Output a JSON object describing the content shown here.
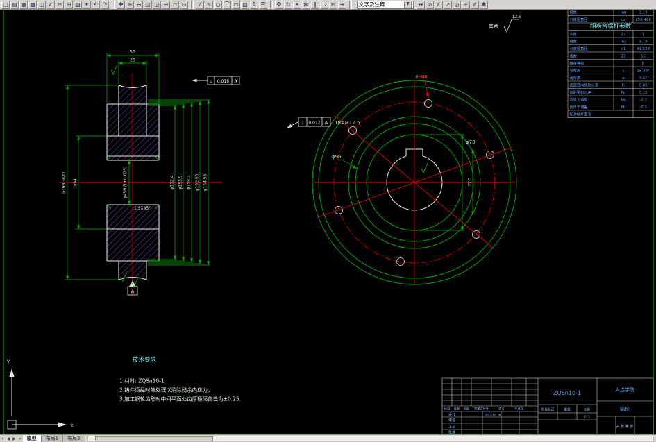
{
  "toolbar": {
    "style_combo": "文字及注释",
    "icons": [
      {
        "name": "new-icon",
        "glyph": "□"
      },
      {
        "name": "open-icon",
        "glyph": "▤"
      },
      {
        "name": "save-icon",
        "glyph": "▦"
      },
      {
        "name": "plot-icon",
        "glyph": "▩"
      },
      {
        "name": "plot-preview-icon",
        "glyph": "◫"
      },
      {
        "name": "spell-icon",
        "glyph": "✓"
      },
      {
        "name": "cut-icon",
        "glyph": "✂"
      },
      {
        "name": "copy-icon",
        "glyph": "⊞"
      },
      {
        "name": "paste-icon",
        "glyph": "▧"
      },
      {
        "name": "match-properties-icon",
        "glyph": "✦"
      },
      {
        "name": "undo-icon",
        "glyph": "↶"
      },
      {
        "name": "redo-icon",
        "glyph": "↷"
      },
      {
        "sep": true
      },
      {
        "name": "pan-icon",
        "glyph": "✚"
      },
      {
        "name": "zoom-realtime-icon",
        "glyph": "⊕"
      },
      {
        "name": "zoom-out-icon",
        "glyph": "⊖"
      },
      {
        "name": "zoom-window-icon",
        "glyph": "◱"
      },
      {
        "name": "zoom-previous-icon",
        "glyph": "◲"
      },
      {
        "name": "distance-icon",
        "glyph": "↔"
      },
      {
        "name": "area-icon",
        "glyph": "▱"
      },
      {
        "name": "id-point-icon",
        "glyph": "⊙"
      },
      {
        "sep": true
      },
      {
        "name": "line-icon",
        "glyph": "╱"
      },
      {
        "name": "polyline-icon",
        "glyph": "∿"
      },
      {
        "name": "circle-icon",
        "glyph": "○"
      },
      {
        "name": "arc-icon",
        "glyph": "⌒"
      },
      {
        "name": "rectangle-icon",
        "glyph": "▭"
      },
      {
        "name": "hatch-icon",
        "glyph": "▨"
      },
      {
        "name": "text-icon",
        "glyph": "A"
      },
      {
        "name": "table-icon",
        "glyph": "☰"
      },
      {
        "sep": true
      },
      {
        "name": "move-icon",
        "glyph": "✜"
      },
      {
        "name": "rotate-icon",
        "glyph": "↻"
      },
      {
        "name": "erase-icon",
        "glyph": "✕"
      },
      {
        "name": "mirror-icon",
        "glyph": "⋈"
      },
      {
        "name": "offset-icon",
        "glyph": "∥"
      },
      {
        "name": "array-icon",
        "glyph": "∷"
      },
      {
        "name": "trim-icon",
        "glyph": "✄"
      },
      {
        "name": "extend-icon",
        "glyph": "⇥"
      }
    ],
    "icons_right": [
      {
        "name": "dim-linear-icon",
        "glyph": "↔"
      },
      {
        "name": "dim-radius-icon",
        "glyph": "⊘"
      },
      {
        "name": "dim-angular-icon",
        "glyph": "∠"
      },
      {
        "name": "leader-icon",
        "glyph": "↗"
      },
      {
        "name": "tolerance-icon",
        "glyph": "◎"
      },
      {
        "name": "center-mark-icon",
        "glyph": "+"
      },
      {
        "name": "dim-edit-icon",
        "glyph": "✐"
      },
      {
        "name": "dim-style-icon",
        "glyph": "✱"
      }
    ]
  },
  "canvas": {
    "surface_note": {
      "label": "其余",
      "value": "12.5"
    },
    "left_view": {
      "dims": {
        "width_outer": "52",
        "width_rim": "28",
        "d_outer": "φ193H8/f7",
        "d_hub": "φ94",
        "bore": "φ45H7(+0.025)",
        "chamfer": "1.5X45°"
      },
      "stack_dims": [
        "φ152.4",
        "φ153.9",
        "φ159.3",
        "φ162.66",
        "φ164.95"
      ],
      "fcf": {
        "sym": "⊥",
        "tol": "0.018",
        "datum": "A"
      },
      "datum_label": "A"
    },
    "right_view": {
      "labels": {
        "holes": "6-M6",
        "recess": "φ96",
        "hub": "φ78",
        "keyway": "72.5",
        "note": "18=M12.5"
      },
      "fcf": {
        "sym": "⊥",
        "tol": "0.012",
        "datum": "A"
      }
    },
    "tech_req": {
      "title": "技术要求",
      "items": [
        "1.材料: ZQSn10-1",
        "2.铸件须经时效处理以消除残余内应力。",
        "3.加工蜗轮齿形时中间平面处齿厚极限偏差为±0.25."
      ]
    },
    "param_table": {
      "rows": [
        {
          "label": "模数",
          "sym": "mn",
          "val": "3.19"
        },
        {
          "label": "分度圆直径",
          "sym": "da",
          "val": "159.466"
        },
        {
          "label": "相啮合蜗杆参数",
          "sym": "",
          "val": "",
          "header": true
        },
        {
          "label": "头数",
          "sym": "Z1",
          "val": "1"
        },
        {
          "label": "模数",
          "sym": "mx",
          "val": "3.19"
        },
        {
          "label": "分度圆直径",
          "sym": "d1",
          "val": "41.534"
        },
        {
          "label": "齿数",
          "sym": "Z2",
          "val": "65"
        },
        {
          "label": "精度等级",
          "sym": "",
          "val": "8"
        },
        {
          "label": "导程角",
          "sym": "γ",
          "val": "16.38°"
        },
        {
          "label": "齿形角",
          "sym": "α",
          "val": "4.5°"
        },
        {
          "label": "齿圈径向跳动公差",
          "sym": "Fr",
          "val": "0.05"
        },
        {
          "label": "齿距累积公差",
          "sym": "Fp",
          "val": "0.15"
        },
        {
          "label": "齿厚上偏差",
          "sym": "Ms",
          "val": "-0.1"
        },
        {
          "label": "齿厚下偏差",
          "sym": "Mi",
          "val": "-0.1"
        },
        {
          "label": "配对蜗杆图号",
          "sym": "",
          "val": ""
        }
      ]
    },
    "title_block": {
      "part_code": "ZQSn10-1",
      "org": "大连学院",
      "part_name": "蜗轮",
      "stage_label": "阶段标记",
      "weight_label": "重量",
      "scale_label": "比例",
      "scale_value": "1:1",
      "sheet_note": "共 张 第 张",
      "date": "2014.05.26",
      "revision_headers": [
        "标记",
        "处数",
        "分区",
        "更改文件号",
        "签名",
        "年月日"
      ],
      "role_labels": [
        "设计",
        "审核",
        "工艺",
        "批准"
      ]
    },
    "ucs": {
      "x": "X",
      "y": "Y"
    }
  },
  "tabs": {
    "nav": [
      "«",
      "◀",
      "▶",
      "»"
    ],
    "items": [
      {
        "label": "模型",
        "active": true
      },
      {
        "label": "布局1",
        "active": false
      },
      {
        "label": "布局2",
        "active": false
      }
    ]
  }
}
